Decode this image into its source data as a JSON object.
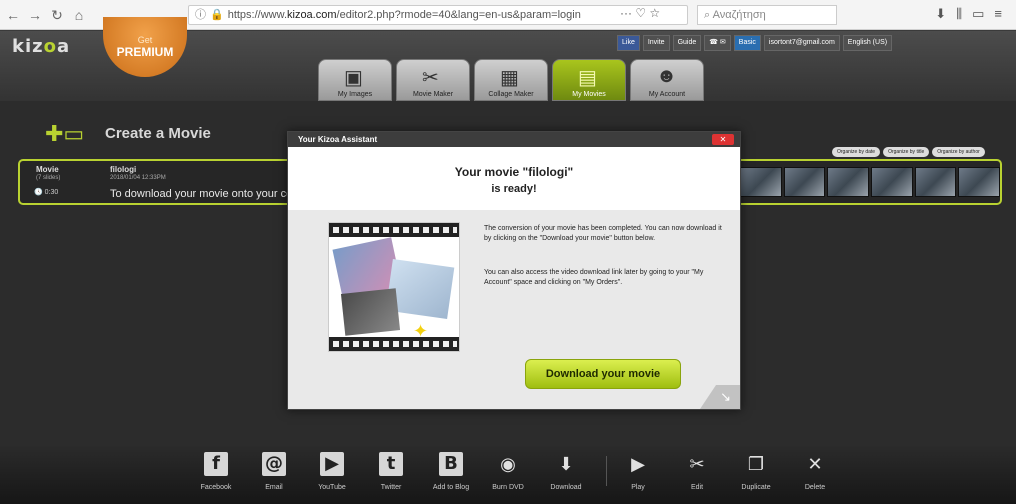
{
  "browser": {
    "url_prefix": "https://www.",
    "url_domain": "kizoa.com",
    "url_rest": "/editor2.php?rmode=40&lang=en-us&param=login",
    "url_extras": "··· ♡ ☆",
    "search_placeholder": "Αναζήτηση"
  },
  "header": {
    "logo_pre": "kiz",
    "logo_o": "o",
    "logo_post": "a",
    "premium_get": "Get",
    "premium_label": "PREMIUM",
    "social": {
      "like": "Like",
      "invite": "Invite",
      "guide": "Guide",
      "basic": "Basic",
      "email": "isortont7@gmail.com",
      "language": "English (US)"
    },
    "tabs": [
      {
        "label": "My Images",
        "icon": "images-icon"
      },
      {
        "label": "Movie Maker",
        "icon": "clapperboard-icon"
      },
      {
        "label": "Collage Maker",
        "icon": "collage-icon"
      },
      {
        "label": "My Movies",
        "icon": "film-icon"
      },
      {
        "label": "My Account",
        "icon": "people-icon"
      }
    ]
  },
  "content": {
    "create_title": "Create a Movie",
    "organize_buttons": [
      "Organize by date",
      "Organize by title",
      "Organize by author"
    ],
    "movie": {
      "type_label": "Movie",
      "clips": "(7 slides)",
      "duration": "0:30",
      "name": "filologi",
      "date": "2018/01/04 12:33PM",
      "message": "To download your movie onto your co"
    }
  },
  "modal": {
    "title": "Your Kizoa Assistant",
    "close": "✕",
    "ready_line1": "Your movie \"filologi\"",
    "ready_line2": "is ready!",
    "desc1": "The conversion of your movie has been completed. You can now download it by clicking on the \"Download your movie\" button below.",
    "desc2": "You can also access the video download link later by going to your \"My Account\" space and clicking on \"My Orders\".",
    "download_button": "Download your movie"
  },
  "toolbar": {
    "items": [
      {
        "label": "Facebook",
        "icon": "facebook-icon",
        "glyph": "f"
      },
      {
        "label": "Email",
        "icon": "email-icon",
        "glyph": "@"
      },
      {
        "label": "YouTube",
        "icon": "youtube-icon",
        "glyph": "▶"
      },
      {
        "label": "Twitter",
        "icon": "twitter-icon",
        "glyph": "t"
      },
      {
        "label": "Add to Blog",
        "icon": "blog-icon",
        "glyph": "B"
      },
      {
        "label": "Burn DVD",
        "icon": "dvd-icon",
        "glyph": "◉"
      },
      {
        "label": "Download",
        "icon": "download-icon",
        "glyph": "⬇"
      },
      {
        "label": "Play",
        "icon": "play-icon",
        "glyph": "▶"
      },
      {
        "label": "Edit",
        "icon": "edit-icon",
        "glyph": "✂"
      },
      {
        "label": "Duplicate",
        "icon": "duplicate-icon",
        "glyph": "❐"
      },
      {
        "label": "Delete",
        "icon": "delete-icon",
        "glyph": "✕"
      }
    ]
  },
  "colors": {
    "accent_green": "#b9d231",
    "premium_orange": "#e08a2c",
    "close_red": "#dd3333"
  }
}
